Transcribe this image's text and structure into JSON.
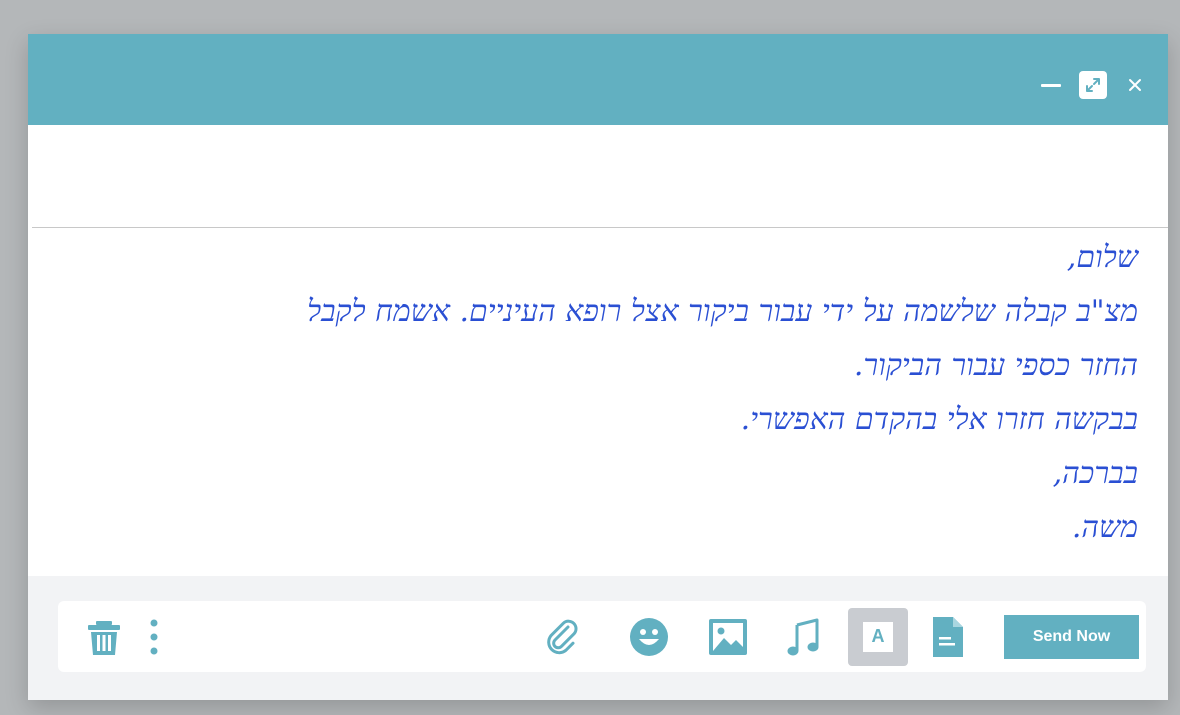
{
  "window": {
    "controls": [
      "minimize",
      "expand",
      "close"
    ]
  },
  "message": {
    "lines": [
      "שלום,",
      "מצ\"ב קבלה שלשמה על ידי עבור ביקור אצל רופא העיניים. אשמח לקבל",
      "החזר כספי עבור הביקור.",
      "בבקשה חזרו אלי בהקדם האפשרי.",
      "בברכה,",
      "משה."
    ]
  },
  "toolbar": {
    "text_format_label": "A",
    "send_label": "Send Now"
  },
  "colors": {
    "accent": "#62b0c1",
    "handwriting": "#2a4fd3",
    "footer_bg": "#f2f3f5",
    "selected_tool_bg": "#c9ccd1"
  },
  "icons": {
    "delete": "trash-icon",
    "more": "more-vertical-icon",
    "attach": "paperclip-icon",
    "emoji": "smiley-icon",
    "image": "image-icon",
    "audio": "music-note-icon",
    "text": "text-format-icon",
    "document": "document-icon"
  }
}
